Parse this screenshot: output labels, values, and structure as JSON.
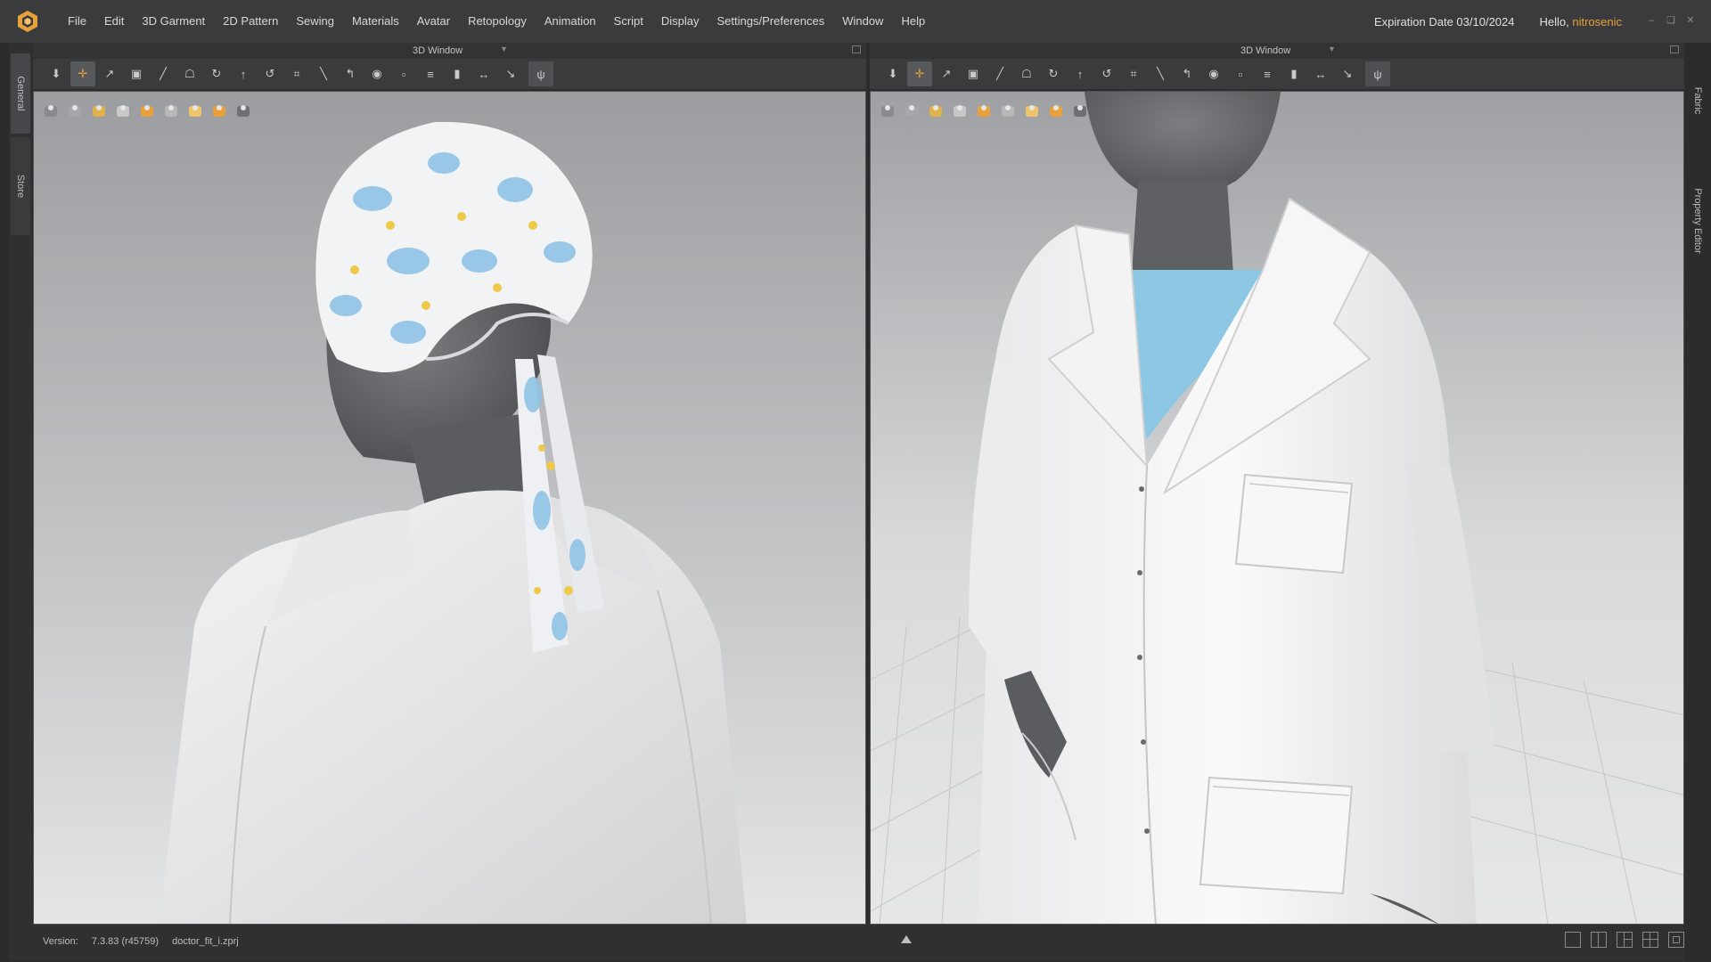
{
  "app": {
    "menu": [
      "File",
      "Edit",
      "3D Garment",
      "2D Pattern",
      "Sewing",
      "Materials",
      "Avatar",
      "Retopology",
      "Animation",
      "Script",
      "Display",
      "Settings/Preferences",
      "Window",
      "Help"
    ],
    "expiration_label": "Expiration Date 03/10/2024",
    "greeting": "Hello, ",
    "username": "nitrosenic",
    "colors": {
      "accent": "#e8a13a",
      "bg": "#2b2c2e",
      "menubar": "#3a3b3d"
    }
  },
  "left_tabs": [
    "General",
    "Store"
  ],
  "right_tabs": [
    "Fabric",
    "Property Editor"
  ],
  "panels": [
    {
      "title": "3D Window",
      "selected_tool": "translate-tool"
    },
    {
      "title": "3D Window",
      "selected_tool": "translate-tool"
    }
  ],
  "toolbar_icons": [
    "select-arrow-icon",
    "move-cross-icon",
    "edit-pin-icon",
    "garment-select-icon",
    "measure-icon",
    "fold-icon",
    "tack-icon",
    "lift-icon",
    "rotate-icon",
    "grid-icon",
    "sew-icon",
    "fold-arrange-icon",
    "circle-icon",
    "button-icon",
    "zipper-icon",
    "trim-icon",
    "split-icon",
    "tuck-icon",
    "puckering-icon"
  ],
  "view_icons": [
    "fabric-solid-icon",
    "fabric-texture-icon",
    "fabric-mesh-icon",
    "avatar-icon",
    "render-icon",
    "shaded-icon",
    "skin-icon",
    "avatar-head-icon",
    "lights-icon"
  ],
  "status": {
    "version_label": "Version:",
    "version": "7.3.83 (r45759)",
    "filename": "doctor_fit_i.zprj"
  }
}
